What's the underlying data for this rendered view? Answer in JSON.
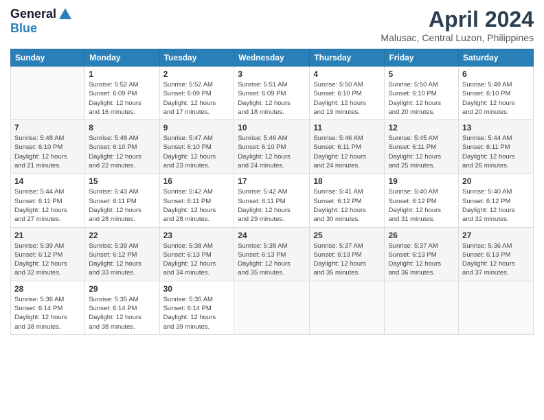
{
  "logo": {
    "line1": "General",
    "line2": "Blue"
  },
  "title": "April 2024",
  "subtitle": "Malusac, Central Luzon, Philippines",
  "days_of_week": [
    "Sunday",
    "Monday",
    "Tuesday",
    "Wednesday",
    "Thursday",
    "Friday",
    "Saturday"
  ],
  "weeks": [
    [
      {
        "day": "",
        "info": ""
      },
      {
        "day": "1",
        "info": "Sunrise: 5:52 AM\nSunset: 6:09 PM\nDaylight: 12 hours\nand 16 minutes."
      },
      {
        "day": "2",
        "info": "Sunrise: 5:52 AM\nSunset: 6:09 PM\nDaylight: 12 hours\nand 17 minutes."
      },
      {
        "day": "3",
        "info": "Sunrise: 5:51 AM\nSunset: 6:09 PM\nDaylight: 12 hours\nand 18 minutes."
      },
      {
        "day": "4",
        "info": "Sunrise: 5:50 AM\nSunset: 6:10 PM\nDaylight: 12 hours\nand 19 minutes."
      },
      {
        "day": "5",
        "info": "Sunrise: 5:50 AM\nSunset: 6:10 PM\nDaylight: 12 hours\nand 20 minutes."
      },
      {
        "day": "6",
        "info": "Sunrise: 5:49 AM\nSunset: 6:10 PM\nDaylight: 12 hours\nand 20 minutes."
      }
    ],
    [
      {
        "day": "7",
        "info": "Sunrise: 5:48 AM\nSunset: 6:10 PM\nDaylight: 12 hours\nand 21 minutes."
      },
      {
        "day": "8",
        "info": "Sunrise: 5:48 AM\nSunset: 6:10 PM\nDaylight: 12 hours\nand 22 minutes."
      },
      {
        "day": "9",
        "info": "Sunrise: 5:47 AM\nSunset: 6:10 PM\nDaylight: 12 hours\nand 23 minutes."
      },
      {
        "day": "10",
        "info": "Sunrise: 5:46 AM\nSunset: 6:10 PM\nDaylight: 12 hours\nand 24 minutes."
      },
      {
        "day": "11",
        "info": "Sunrise: 5:46 AM\nSunset: 6:11 PM\nDaylight: 12 hours\nand 24 minutes."
      },
      {
        "day": "12",
        "info": "Sunrise: 5:45 AM\nSunset: 6:11 PM\nDaylight: 12 hours\nand 25 minutes."
      },
      {
        "day": "13",
        "info": "Sunrise: 5:44 AM\nSunset: 6:11 PM\nDaylight: 12 hours\nand 26 minutes."
      }
    ],
    [
      {
        "day": "14",
        "info": "Sunrise: 5:44 AM\nSunset: 6:11 PM\nDaylight: 12 hours\nand 27 minutes."
      },
      {
        "day": "15",
        "info": "Sunrise: 5:43 AM\nSunset: 6:11 PM\nDaylight: 12 hours\nand 28 minutes."
      },
      {
        "day": "16",
        "info": "Sunrise: 5:42 AM\nSunset: 6:11 PM\nDaylight: 12 hours\nand 28 minutes."
      },
      {
        "day": "17",
        "info": "Sunrise: 5:42 AM\nSunset: 6:11 PM\nDaylight: 12 hours\nand 29 minutes."
      },
      {
        "day": "18",
        "info": "Sunrise: 5:41 AM\nSunset: 6:12 PM\nDaylight: 12 hours\nand 30 minutes."
      },
      {
        "day": "19",
        "info": "Sunrise: 5:40 AM\nSunset: 6:12 PM\nDaylight: 12 hours\nand 31 minutes."
      },
      {
        "day": "20",
        "info": "Sunrise: 5:40 AM\nSunset: 6:12 PM\nDaylight: 12 hours\nand 32 minutes."
      }
    ],
    [
      {
        "day": "21",
        "info": "Sunrise: 5:39 AM\nSunset: 6:12 PM\nDaylight: 12 hours\nand 32 minutes."
      },
      {
        "day": "22",
        "info": "Sunrise: 5:39 AM\nSunset: 6:12 PM\nDaylight: 12 hours\nand 33 minutes."
      },
      {
        "day": "23",
        "info": "Sunrise: 5:38 AM\nSunset: 6:13 PM\nDaylight: 12 hours\nand 34 minutes."
      },
      {
        "day": "24",
        "info": "Sunrise: 5:38 AM\nSunset: 6:13 PM\nDaylight: 12 hours\nand 35 minutes."
      },
      {
        "day": "25",
        "info": "Sunrise: 5:37 AM\nSunset: 6:13 PM\nDaylight: 12 hours\nand 35 minutes."
      },
      {
        "day": "26",
        "info": "Sunrise: 5:37 AM\nSunset: 6:13 PM\nDaylight: 12 hours\nand 36 minutes."
      },
      {
        "day": "27",
        "info": "Sunrise: 5:36 AM\nSunset: 6:13 PM\nDaylight: 12 hours\nand 37 minutes."
      }
    ],
    [
      {
        "day": "28",
        "info": "Sunrise: 5:36 AM\nSunset: 6:14 PM\nDaylight: 12 hours\nand 38 minutes."
      },
      {
        "day": "29",
        "info": "Sunrise: 5:35 AM\nSunset: 6:14 PM\nDaylight: 12 hours\nand 38 minutes."
      },
      {
        "day": "30",
        "info": "Sunrise: 5:35 AM\nSunset: 6:14 PM\nDaylight: 12 hours\nand 39 minutes."
      },
      {
        "day": "",
        "info": ""
      },
      {
        "day": "",
        "info": ""
      },
      {
        "day": "",
        "info": ""
      },
      {
        "day": "",
        "info": ""
      }
    ]
  ]
}
